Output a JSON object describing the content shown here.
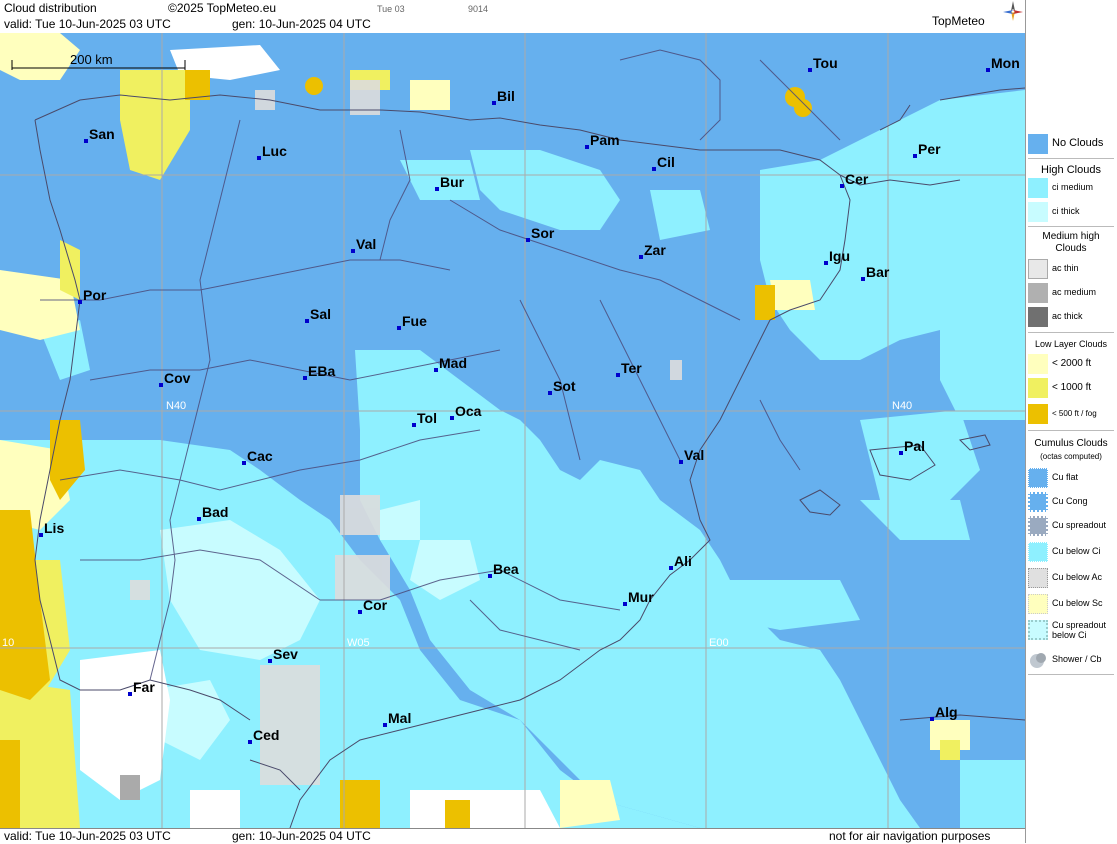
{
  "header": {
    "title": "Cloud distribution",
    "copyright": "©2025 TopMeteo.eu",
    "valid": "valid:  Tue  10-Jun-2025  03 UTC",
    "gen": "gen: 10-Jun-2025 04 UTC",
    "tag1": "Tue 03",
    "tag2": "9014",
    "logo": "TopMeteo"
  },
  "footer": {
    "valid": "valid:  Tue  10-Jun-2025  03 UTC",
    "gen": "gen: 10-Jun-2025 04 UTC",
    "disclaimer": "not for air navigation purposes"
  },
  "map": {
    "scale_label": "200 km",
    "grid_labels": {
      "n40_left": "N40",
      "n40_right": "N40",
      "w05": "W05",
      "e00": "E00",
      "w10": "10"
    },
    "cities": [
      "Tou",
      "Mon",
      "Bil",
      "San",
      "Pam",
      "Luc",
      "Cil",
      "Per",
      "Bur",
      "Cer",
      "Sor",
      "Val",
      "Zar",
      "Igu",
      "Bar",
      "Por",
      "Sal",
      "Fue",
      "Mad",
      "EBa",
      "Cov",
      "Ter",
      "Sot",
      "Tol",
      "Oca",
      "Pal",
      "Val",
      "Cac",
      "Bad",
      "Lis",
      "Ali",
      "Bea",
      "Mur",
      "Cor",
      "Sev",
      "Far",
      "Mal",
      "Ced",
      "Alg"
    ],
    "colors": {
      "no_clouds": "#66b0ee",
      "ci_medium": "#8ef0ff",
      "ci_thick": "#c8fcff",
      "low_2000": "#ffffbe",
      "low_1000": "#f0f060",
      "low_500": "#ecc000",
      "white": "#ffffff"
    }
  },
  "legend": {
    "no_clouds": "No Clouds",
    "high_title": "High Clouds",
    "ci_medium": "ci medium",
    "ci_thick": "ci thick",
    "medium_title": "Medium high Clouds",
    "ac_thin": "ac thin",
    "ac_medium": "ac medium",
    "ac_thick": "ac thick",
    "low_title": "Low Layer Clouds",
    "low_2000": "< 2000 ft",
    "low_1000": "< 1000 ft",
    "low_500": "< 500 ft / fog",
    "cu_title": "Cumulus Clouds",
    "cu_sub": "(octas computed)",
    "cu_flat": "Cu flat",
    "cu_cong": "Cu Cong",
    "cu_spreadout": "Cu spreadout",
    "cu_below_ci": "Cu below Ci",
    "cu_below_ac": "Cu below Ac",
    "cu_below_sc": "Cu below Sc",
    "cu_spreadout_below_ci": "Cu spreadout below Ci",
    "shower": "Shower / Cb"
  }
}
